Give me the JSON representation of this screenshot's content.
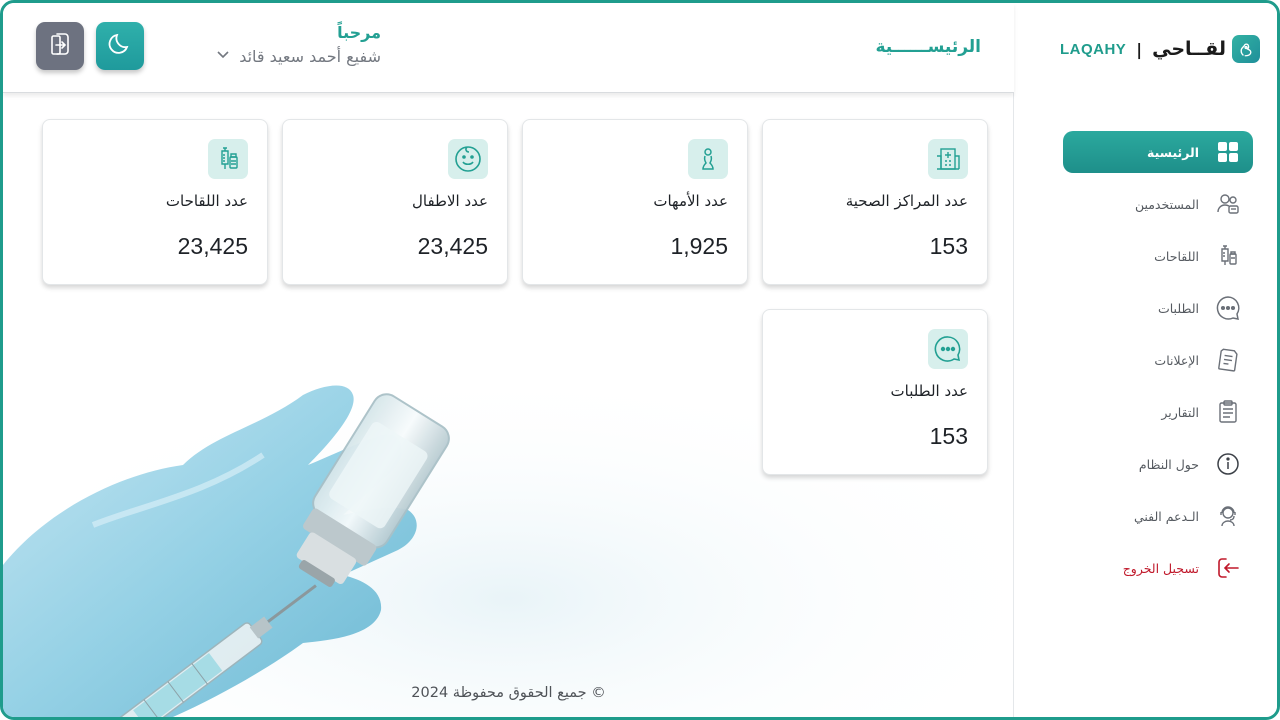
{
  "brand": {
    "arabic": "لقــاحي",
    "separator": "|",
    "english": "LAQAHY"
  },
  "header": {
    "page_title": "الرئيســــــية",
    "welcome": "مرحباً",
    "user_name": "شفيع أحمد سعيد قائد"
  },
  "sidebar": {
    "items": [
      {
        "label": "الرئيسية",
        "icon": "grid-icon",
        "active": true
      },
      {
        "label": "المستخدمين",
        "icon": "users-icon"
      },
      {
        "label": "اللقاحات",
        "icon": "vaccine-icon"
      },
      {
        "label": "الطلبات",
        "icon": "chat-bubble-icon"
      },
      {
        "label": "الإعلانات",
        "icon": "announcement-icon"
      },
      {
        "label": "التقارير",
        "icon": "clipboard-icon"
      },
      {
        "label": "حول النظام",
        "icon": "info-icon"
      },
      {
        "label": "الـدعم الفني",
        "icon": "support-icon"
      },
      {
        "label": "تسجيل الخروج",
        "icon": "logout-icon"
      }
    ]
  },
  "stats": [
    {
      "title": "عدد المراكز الصحية",
      "value": "153",
      "icon": "hospital-icon"
    },
    {
      "title": "عدد الأمهات",
      "value": "1,925",
      "icon": "mother-icon"
    },
    {
      "title": "عدد الاطفال",
      "value": "23,425",
      "icon": "child-face-icon"
    },
    {
      "title": "عدد اللقاحات",
      "value": "23,425",
      "icon": "vaccine-icon"
    },
    {
      "title": "عدد الطلبات",
      "value": "153",
      "icon": "chat-bubble-icon"
    }
  ],
  "footer": {
    "copyright": "جميع الحقوق محفوظة 2024 ©"
  },
  "colors": {
    "accent": "#23a093",
    "logout": "#c0182a",
    "exit_button": "#6d7280"
  }
}
